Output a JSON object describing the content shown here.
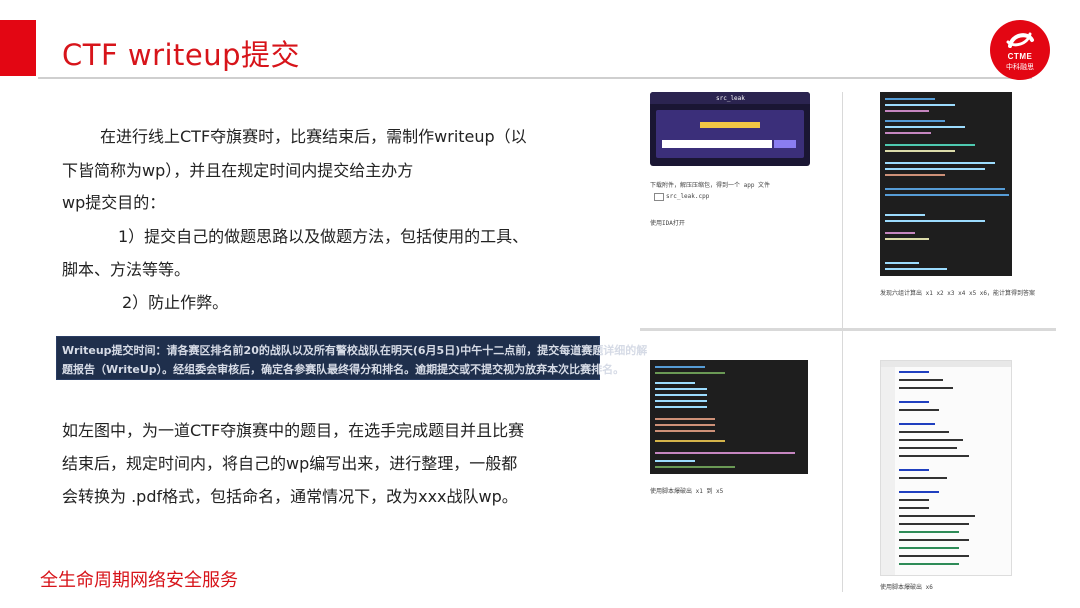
{
  "slide": {
    "title": "CTF writeup提交",
    "logo": {
      "en": "CTME",
      "cn": "中科融思"
    },
    "paragraph1": [
      "在进行线上CTF夺旗赛时，比赛结束后，需制作writeup（以",
      "下皆简称为wp），并且在规定时间内提交给主办方",
      "wp提交目的：",
      "1）提交自己的做题思路以及做题方法，包括使用的工具、",
      "脚本、方法等等。",
      "2）防止作弊。"
    ],
    "notice": {
      "line1": "Writeup提交时间：请各赛区排名前20的战队以及所有警校战队在明天(6月5日)中午十二点前，提交每道赛题详细的解",
      "line2": "题报告（WriteUp）。经组委会审核后，确定各参赛队最终得分和排名。逾期提交或不提交视为放弃本次比赛排名。"
    },
    "paragraph2": [
      "如左图中，为一道CTF夺旗赛中的题目，在选手完成题目并且比赛",
      "结束后，规定时间内，将自己的wp编写出来，进行整理，一般都",
      "会转换为 .pdf格式，包括命名，通常情况下，改为xxx战队wp。"
    ],
    "footer": "全生命周期网络安全服务"
  },
  "doc_preview": {
    "challenge_title": "src_leak",
    "caption_top_left_1": "下载附件，解压压缩包，得到一个 app 文件",
    "caption_top_left_2": "使用IDA打开",
    "file_name": "src_leak.cpp",
    "caption_top_right": "发现六组计算出 x1 x2 x3 x4 x5 x6，能计算得到答案",
    "caption_bottom_left": "使用脚本爆破出 x1 到 x5",
    "caption_bottom_right": "使用脚本爆破出 x6"
  },
  "colors": {
    "brand_red": "#e30613",
    "title_red": "#d7141a",
    "notice_bg": "#1f2f4c",
    "code_bg": "#1e1e1e"
  }
}
